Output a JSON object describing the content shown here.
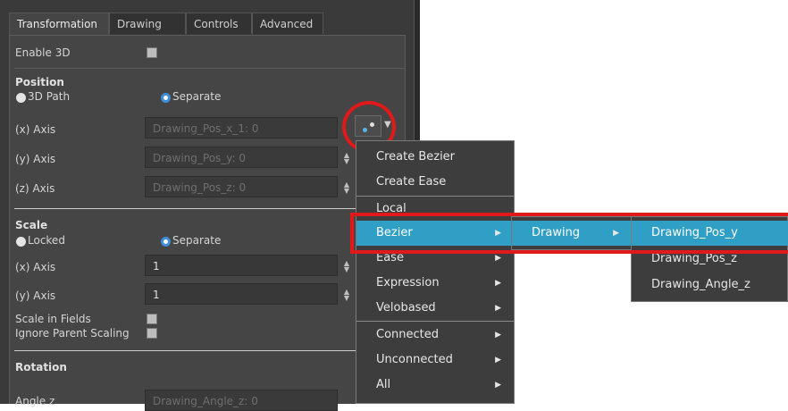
{
  "tabs": [
    "Transformation",
    "Drawing",
    "Controls",
    "Advanced"
  ],
  "enable_3d": {
    "label": "Enable 3D",
    "checked": false
  },
  "position": {
    "header": "Position",
    "option_path": "3D Path",
    "option_separate": "Separate",
    "x_label": "(x) Axis",
    "x_value": "Drawing_Pos_x_1: 0",
    "y_label": "(y) Axis",
    "y_value": "Drawing_Pos_y: 0",
    "z_label": "(z) Axis",
    "z_value": "Drawing_Pos_z: 0"
  },
  "scale": {
    "header": "Scale",
    "option_locked": "Locked",
    "option_separate": "Separate",
    "x_label": "(x) Axis",
    "x_value": "1",
    "y_label": "(y) Axis",
    "y_value": "1",
    "scale_in_fields": "Scale in Fields",
    "ignore_parent": "Ignore Parent Scaling"
  },
  "rotation": {
    "header": "Rotation",
    "angle_label": "Angle z",
    "angle_value": "Drawing_Angle_z: 0"
  },
  "menu1": [
    "Create Bezier",
    "Create Ease",
    "Local",
    "Bezier",
    "Ease",
    "Expression",
    "Velobased",
    "Connected",
    "Unconnected",
    "All"
  ],
  "menu2": [
    "Drawing"
  ],
  "menu3": [
    "Drawing_Pos_y",
    "Drawing_Pos_z",
    "Drawing_Angle_z"
  ],
  "colors": {
    "highlight": "#2f9fc6",
    "annotation": "#e01a1a",
    "panel": "#454545"
  }
}
